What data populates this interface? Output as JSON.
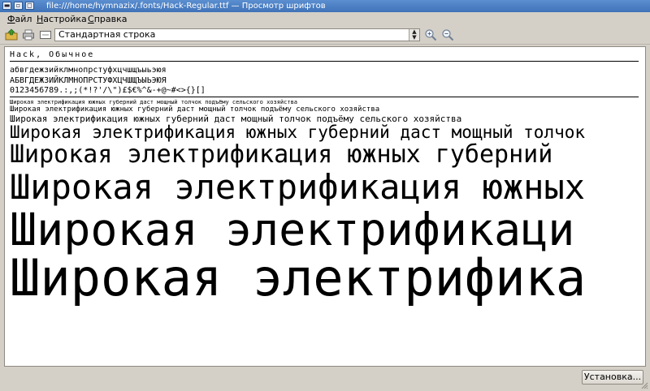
{
  "window": {
    "title": "file:///home/hymnazix/.fonts/Hack-Regular.ttf — Просмотр шрифтов"
  },
  "menu": {
    "file": {
      "mnemonic": "Ф",
      "rest": "айл"
    },
    "settings": {
      "mnemonic": "Н",
      "rest": "астройка"
    },
    "help": {
      "mnemonic": "С",
      "rest": "правка"
    }
  },
  "toolbar": {
    "mode_value": "Стандартная строка",
    "icons": [
      "open-icon",
      "print-icon",
      "view-icon",
      "zoom-in-icon",
      "zoom-out-icon"
    ]
  },
  "preview": {
    "font_name": "Hack, Обычное",
    "lowercase": "абвгдежзийклмнопрстуфхцчшщъыьэюя",
    "uppercase": "АБВГДЕЖЗИЙКЛМНОПРСТУФХЦЧШЩЪЫЬЭЮЯ",
    "digits_symbols": "0123456789.:,;(*!?'/\\\")£$€%^&-+@~#<>{}[]",
    "sample_small": [
      "Широкая электрификация южных губерний даст мощный толчок подъёму сельского хозяйства",
      "Широкая электрификация южных губерний даст мощный толчок подъёму сельского хозяйства",
      "Широкая электрификация южных губерний даст мощный толчок подъёму сельского хозяйства"
    ],
    "sample_large": [
      "Широкая электрификация южных губерний даст мощный толчок",
      "Широкая электрификация южных губерний",
      "Широкая электрификация южных",
      "Широкая электрификаци",
      "Широкая электрифика"
    ]
  },
  "footer": {
    "install_label": "Установка..."
  }
}
